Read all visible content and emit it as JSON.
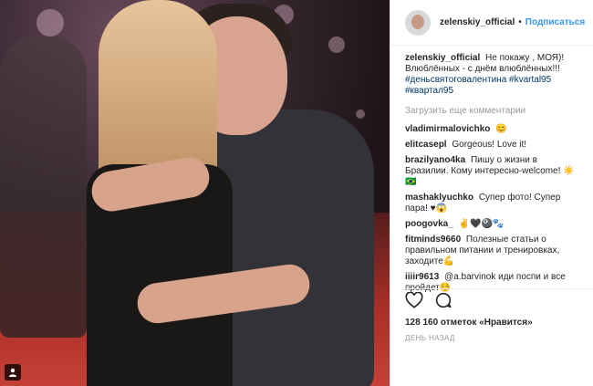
{
  "post": {
    "username": "zelenskiy_official",
    "follow_label": "Подписаться",
    "dot": "•"
  },
  "caption": {
    "user": "zelenskiy_official",
    "text": "Не покажу , МОЯ)! Влюблённых - с днём влюблённых!!!",
    "tags": "#деньсвятоговалентина #kvartal95 #квартал95"
  },
  "load_more": "Загрузить еще комментарии",
  "comments": [
    {
      "user": "vladimirmalovichko",
      "text": "😊"
    },
    {
      "user": "elitcasepl",
      "text": "Gorgeous! Love it!"
    },
    {
      "user": "brazilyano4ka",
      "text": "Пишу о жизни в Бразилии. Кому интересно-welcome! ☀️🇧🇷"
    },
    {
      "user": "mashaklyuchko",
      "text": "Супер фото! Супер пара! ♥😱"
    },
    {
      "user": "poogovka_",
      "text": "✌️🖤🎱🐾"
    },
    {
      "user": "fitminds9660",
      "text": "Полезные статьи о правильном питании и тренировках, заходите💪"
    },
    {
      "user": "iiiir9613",
      "text": "@a.barvinok иди поспи и все пройдет☺️"
    }
  ],
  "likes": "128 160 отметок «Нравится»",
  "time": "ДЕНЬ НАЗАД",
  "icons": {
    "like": "heart-icon",
    "comment": "comment-icon",
    "user_tag": "person-icon"
  }
}
